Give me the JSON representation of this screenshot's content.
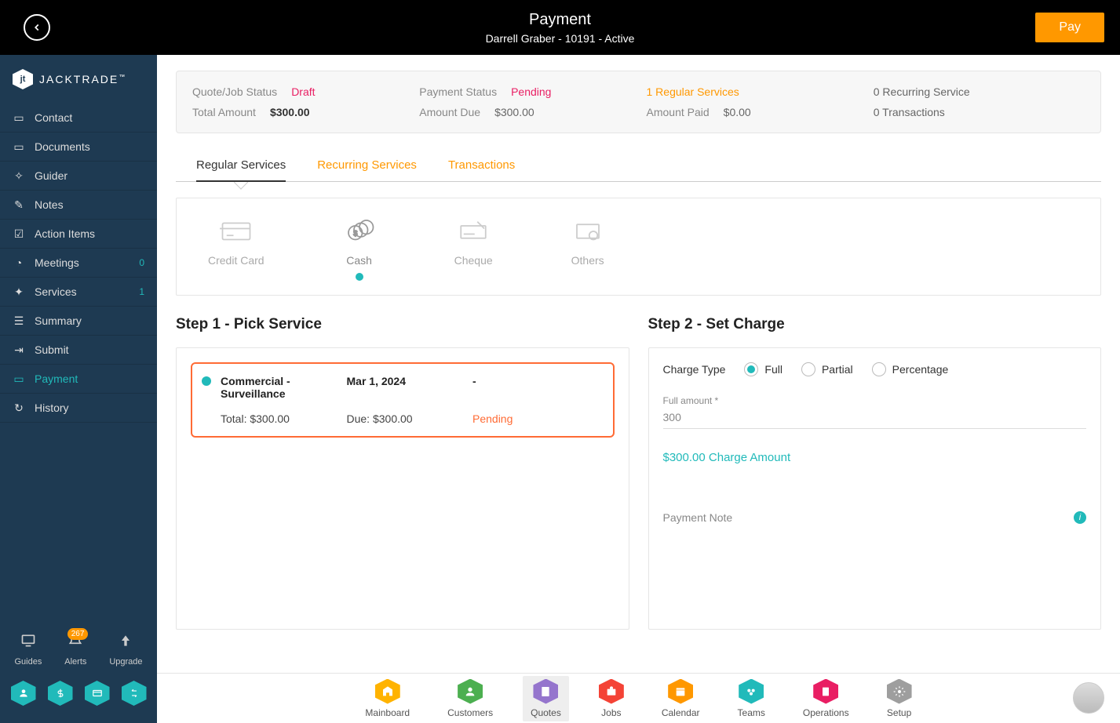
{
  "header": {
    "title": "Payment",
    "subtitle": "Darrell Graber - 10191 - Active",
    "pay_label": "Pay"
  },
  "brand": {
    "name": "JACKTRADE",
    "tm": "™"
  },
  "sidebar": {
    "items": [
      {
        "label": "Contact"
      },
      {
        "label": "Documents"
      },
      {
        "label": "Guider"
      },
      {
        "label": "Notes"
      },
      {
        "label": "Action Items"
      },
      {
        "label": "Meetings",
        "badge": "0"
      },
      {
        "label": "Services",
        "badge": "1"
      },
      {
        "label": "Summary"
      },
      {
        "label": "Submit"
      },
      {
        "label": "Payment",
        "active": true
      },
      {
        "label": "History"
      }
    ],
    "bottom": {
      "guides": "Guides",
      "alerts": "Alerts",
      "alerts_count": "267",
      "upgrade": "Upgrade"
    }
  },
  "summary": {
    "row1": {
      "quote_status_label": "Quote/Job Status",
      "quote_status_value": "Draft",
      "payment_status_label": "Payment Status",
      "payment_status_value": "Pending",
      "regular_services": "1 Regular Services",
      "recurring_service": "0 Recurring Service"
    },
    "row2": {
      "total_amount_label": "Total Amount",
      "total_amount_value": "$300.00",
      "amount_due_label": "Amount Due",
      "amount_due_value": "$300.00",
      "amount_paid_label": "Amount Paid",
      "amount_paid_value": "$0.00",
      "transactions": "0 Transactions"
    }
  },
  "tabs": {
    "regular": "Regular Services",
    "recurring": "Recurring Services",
    "transactions": "Transactions"
  },
  "methods": {
    "credit": "Credit Card",
    "cash": "Cash",
    "cheque": "Cheque",
    "others": "Others"
  },
  "step1": {
    "title": "Step 1 - Pick Service",
    "service": {
      "name": "Commercial - Surveillance",
      "date": "Mar 1, 2024",
      "extra": "-",
      "total": "Total: $300.00",
      "due": "Due: $300.00",
      "status": "Pending"
    }
  },
  "step2": {
    "title": "Step 2 - Set Charge",
    "charge_type_label": "Charge Type",
    "full": "Full",
    "partial": "Partial",
    "percentage": "Percentage",
    "full_amount_label": "Full amount *",
    "full_amount_value": "300",
    "charge_amount": "$300.00 Charge Amount",
    "note_label": "Payment Note"
  },
  "bottom_nav": [
    {
      "label": "Mainboard",
      "color": "#ffb300"
    },
    {
      "label": "Customers",
      "color": "#4caf50"
    },
    {
      "label": "Quotes",
      "color": "#9575cd",
      "active": true
    },
    {
      "label": "Jobs",
      "color": "#f44336"
    },
    {
      "label": "Calendar",
      "color": "#ff9800"
    },
    {
      "label": "Teams",
      "color": "#21baba"
    },
    {
      "label": "Operations",
      "color": "#e91e63"
    },
    {
      "label": "Setup",
      "color": "#9e9e9e"
    }
  ]
}
